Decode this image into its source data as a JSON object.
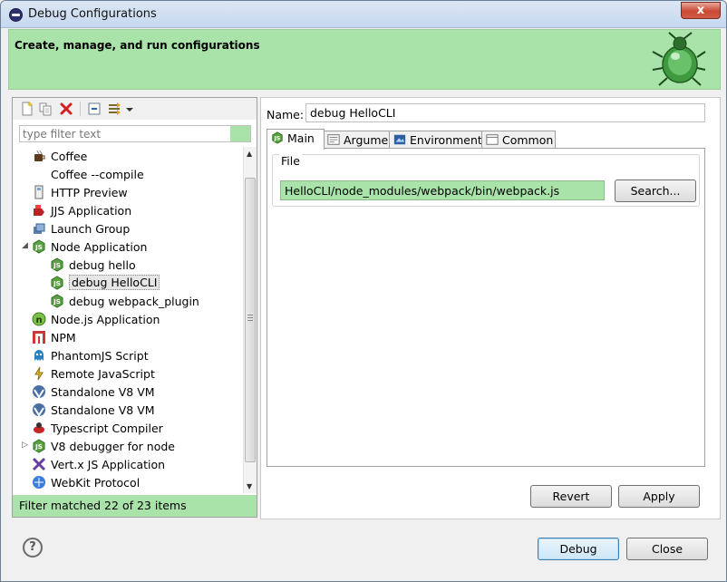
{
  "window": {
    "title": "Debug Configurations",
    "close_glyph": "x"
  },
  "header": {
    "text": "Create, manage, and run configurations",
    "bg_color": "#a9e3a9"
  },
  "left": {
    "toolbar_icons": [
      "new-configuration-icon",
      "duplicate-icon",
      "delete-icon",
      "collapse-all-icon",
      "filter-icon",
      "view-menu-icon"
    ],
    "filter_placeholder": "type filter text",
    "tree": [
      {
        "label": "Coffee",
        "icon": "coffee-icon",
        "depth": 0,
        "expander": ""
      },
      {
        "label": "Coffee --compile",
        "icon": "",
        "depth": 0,
        "expander": ""
      },
      {
        "label": "HTTP Preview",
        "icon": "http-preview-icon",
        "depth": 0,
        "expander": ""
      },
      {
        "label": "JJS Application",
        "icon": "jjs-icon",
        "depth": 0,
        "expander": ""
      },
      {
        "label": "Launch Group",
        "icon": "launch-group-icon",
        "depth": 0,
        "expander": ""
      },
      {
        "label": "Node Application",
        "icon": "nodejs-icon",
        "depth": 0,
        "expander": "expanded"
      },
      {
        "label": "debug hello",
        "icon": "nodejs-icon",
        "depth": 1,
        "expander": ""
      },
      {
        "label": "debug HelloCLI",
        "icon": "nodejs-icon",
        "depth": 1,
        "expander": "",
        "selected": true
      },
      {
        "label": "debug webpack_plugin",
        "icon": "nodejs-icon",
        "depth": 1,
        "expander": ""
      },
      {
        "label": "Node.js Application",
        "icon": "node-n-icon",
        "depth": 0,
        "expander": ""
      },
      {
        "label": "NPM",
        "icon": "npm-icon",
        "depth": 0,
        "expander": ""
      },
      {
        "label": "PhantomJS Script",
        "icon": "phantomjs-icon",
        "depth": 0,
        "expander": ""
      },
      {
        "label": "Remote JavaScript",
        "icon": "remote-js-icon",
        "depth": 0,
        "expander": ""
      },
      {
        "label": "Standalone V8 VM",
        "icon": "v8-vm-icon",
        "depth": 0,
        "expander": ""
      },
      {
        "label": "Standalone V8 VM",
        "icon": "v8-vm-icon",
        "depth": 0,
        "expander": ""
      },
      {
        "label": "Typescript Compiler",
        "icon": "typescript-icon",
        "depth": 0,
        "expander": ""
      },
      {
        "label": "V8 debugger for node",
        "icon": "nodejs-icon",
        "depth": 0,
        "expander": "collapsed"
      },
      {
        "label": "Vert.x JS Application",
        "icon": "vertx-icon",
        "depth": 0,
        "expander": ""
      },
      {
        "label": "WebKit Protocol",
        "icon": "webkit-icon",
        "depth": 0,
        "expander": ""
      }
    ],
    "status": "Filter matched 22 of 23 items"
  },
  "right": {
    "name_label": "Name:",
    "name_value": "debug HelloCLI",
    "tabs": [
      {
        "label": "Main",
        "icon": "nodejs-icon",
        "active": true
      },
      {
        "label": "Arguments",
        "icon": "arguments-icon",
        "active": false
      },
      {
        "label": "Environment",
        "icon": "environment-icon",
        "active": false
      },
      {
        "label": "Common",
        "icon": "common-icon",
        "active": false
      }
    ],
    "file_group_label": "File",
    "file_value": "HelloCLI/node_modules/webpack/bin/webpack.js",
    "search_label": "Search...",
    "revert_label": "Revert",
    "apply_label": "Apply"
  },
  "footer": {
    "debug_label": "Debug",
    "close_label": "Close",
    "help_glyph": "?"
  },
  "colors": {
    "accent_green": "#a9e3a9",
    "node_green": "#4a9b3a",
    "default_button_border": "#3c7fb1"
  }
}
